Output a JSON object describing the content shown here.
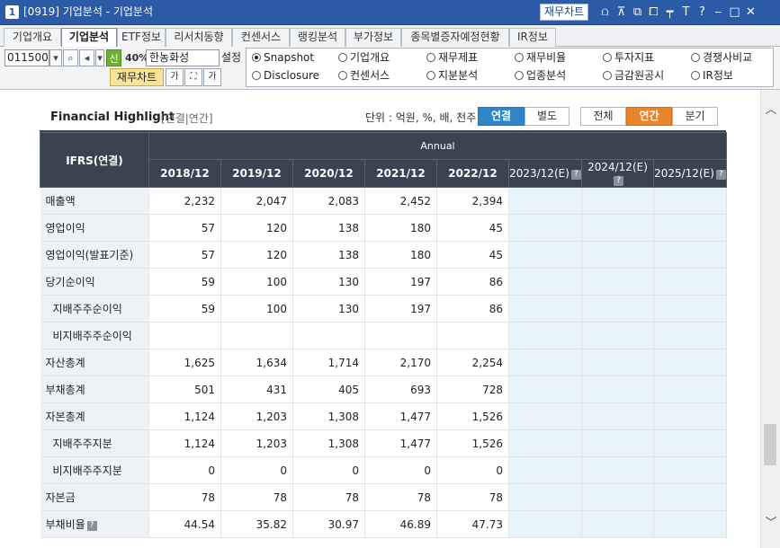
{
  "window": {
    "number": "1",
    "title": "[0919] 기업분석 - 기업분석",
    "chart_button": "재무차트",
    "icons": [
      "chart-icon",
      "pin-icon",
      "link-icon",
      "window-icon",
      "fix-icon",
      "font-icon",
      "help-icon",
      "minimize-icon",
      "maximize-icon",
      "close-icon"
    ],
    "icon_glyphs": [
      "⩍",
      "⊼",
      "⧉",
      "⧠",
      "┯",
      "T",
      "?",
      "‒",
      "□",
      "✕"
    ]
  },
  "tabs": [
    "기업개요",
    "기업분석",
    "ETF정보",
    "리서치동향",
    "컨센서스",
    "랭킹분석",
    "부가정보",
    "종목별증자예정현황",
    "IR정보"
  ],
  "active_tab": "기업분석",
  "toolbar": {
    "code": "011500",
    "new_label": "신",
    "percent": "40%",
    "company": "한농화성",
    "setting_label": "설정",
    "chart_button": "재무차트",
    "ga_label": "가",
    "ga2_label": "가"
  },
  "radios": [
    {
      "label": "Snapshot",
      "selected": true
    },
    {
      "label": "기업개요",
      "selected": false
    },
    {
      "label": "재무제표",
      "selected": false
    },
    {
      "label": "재무비율",
      "selected": false
    },
    {
      "label": "투자지표",
      "selected": false
    },
    {
      "label": "경쟁사비교",
      "selected": false
    },
    {
      "label": "Disclosure",
      "selected": false
    },
    {
      "label": "컨센서스",
      "selected": false
    },
    {
      "label": "지분분석",
      "selected": false
    },
    {
      "label": "업종분석",
      "selected": false
    },
    {
      "label": "금감원공시",
      "selected": false
    },
    {
      "label": "IR정보",
      "selected": false
    }
  ],
  "highlight": {
    "title": "Financial Highlight",
    "subtitle": "[연결|연간]",
    "units": "단위 : 억원, %, 배, 천주",
    "scope_tabs": [
      "연결",
      "별도"
    ],
    "period_tabs": [
      "전체",
      "연간",
      "분기"
    ],
    "colors": {
      "active_scope": "#2e86c9",
      "active_period": "#e8842a",
      "header_bg": "#3a4350",
      "estimate_bg": "#e8f4fb"
    }
  },
  "table": {
    "row_header": "IFRS(연결)",
    "group_header": "Annual",
    "columns": [
      "2018/12",
      "2019/12",
      "2020/12",
      "2021/12",
      "2022/12",
      "2023/12(E)",
      "2024/12(E)",
      "2025/12(E)"
    ],
    "estimate_columns": [
      5,
      6,
      7
    ],
    "rows": [
      {
        "label": "매출액",
        "sub": false,
        "values": [
          "2,232",
          "2,047",
          "2,083",
          "2,452",
          "2,394",
          "",
          "",
          ""
        ]
      },
      {
        "label": "영업이익",
        "sub": false,
        "values": [
          "57",
          "120",
          "138",
          "180",
          "45",
          "",
          "",
          ""
        ]
      },
      {
        "label": "영업이익(발표기준)",
        "sub": false,
        "values": [
          "57",
          "120",
          "138",
          "180",
          "45",
          "",
          "",
          ""
        ]
      },
      {
        "label": "당기순이익",
        "sub": false,
        "values": [
          "59",
          "100",
          "130",
          "197",
          "86",
          "",
          "",
          ""
        ]
      },
      {
        "label": "지배주주순이익",
        "sub": true,
        "values": [
          "59",
          "100",
          "130",
          "197",
          "86",
          "",
          "",
          ""
        ]
      },
      {
        "label": "비지배주주순이익",
        "sub": true,
        "values": [
          "",
          "",
          "",
          "",
          "",
          "",
          "",
          ""
        ]
      },
      {
        "label": "자산총계",
        "sub": false,
        "values": [
          "1,625",
          "1,634",
          "1,714",
          "2,170",
          "2,254",
          "",
          "",
          ""
        ]
      },
      {
        "label": "부채총계",
        "sub": false,
        "values": [
          "501",
          "431",
          "405",
          "693",
          "728",
          "",
          "",
          ""
        ]
      },
      {
        "label": "자본총계",
        "sub": false,
        "values": [
          "1,124",
          "1,203",
          "1,308",
          "1,477",
          "1,526",
          "",
          "",
          ""
        ]
      },
      {
        "label": "지배주주지분",
        "sub": true,
        "values": [
          "1,124",
          "1,203",
          "1,308",
          "1,477",
          "1,526",
          "",
          "",
          ""
        ]
      },
      {
        "label": "비지배주주지분",
        "sub": true,
        "values": [
          "0",
          "0",
          "0",
          "0",
          "0",
          "",
          "",
          ""
        ]
      },
      {
        "label": "자본금",
        "sub": false,
        "values": [
          "78",
          "78",
          "78",
          "78",
          "78",
          "",
          "",
          ""
        ]
      },
      {
        "label": "부채비율",
        "sub": false,
        "help": true,
        "values": [
          "44.54",
          "35.82",
          "30.97",
          "46.89",
          "47.73",
          "",
          "",
          ""
        ]
      }
    ]
  }
}
